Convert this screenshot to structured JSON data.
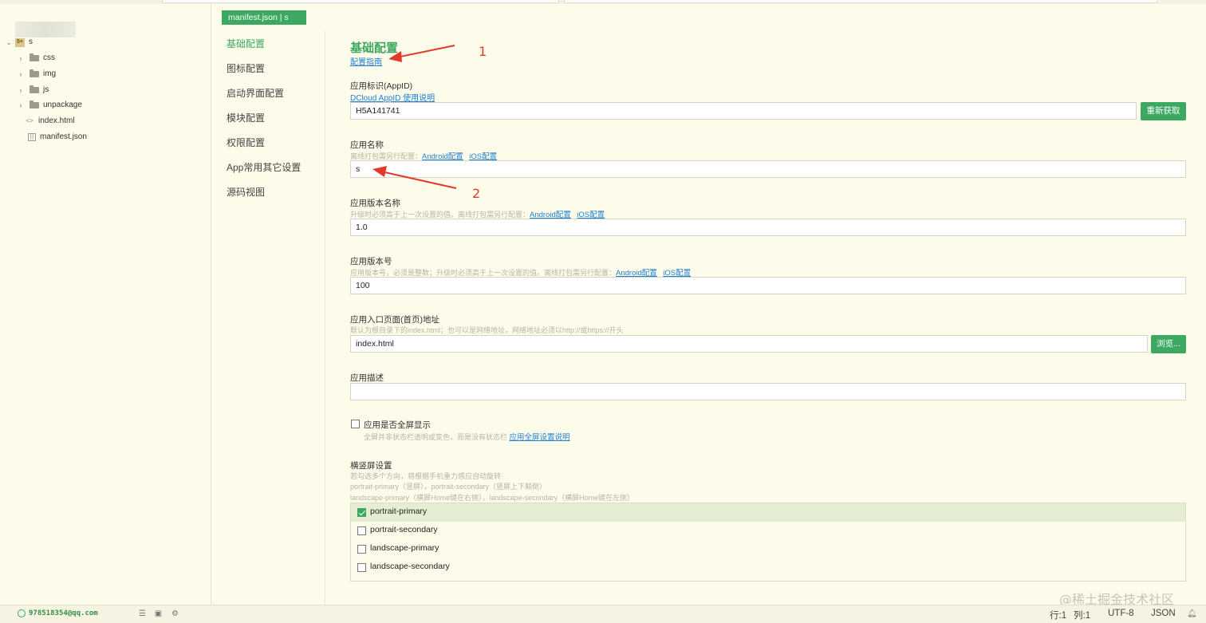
{
  "tree": {
    "project": "s",
    "items": [
      {
        "label": "css",
        "type": "folder"
      },
      {
        "label": "img",
        "type": "folder"
      },
      {
        "label": "js",
        "type": "folder"
      },
      {
        "label": "unpackage",
        "type": "folder"
      },
      {
        "label": "index.html",
        "type": "html"
      },
      {
        "label": "manifest.json",
        "type": "json"
      }
    ]
  },
  "tab": {
    "label": "manifest.json | s"
  },
  "nav": {
    "items": [
      "基础配置",
      "图标配置",
      "启动界面配置",
      "模块配置",
      "权限配置",
      "App常用其它设置",
      "源码视图"
    ],
    "active": "基础配置"
  },
  "main": {
    "title": "基础配置",
    "guide_link": "配置指南",
    "appid": {
      "label": "应用标识(AppID)",
      "help_link": "DCloud AppID 使用说明",
      "value": "H5A141741",
      "button": "重新获取"
    },
    "appname": {
      "label": "应用名称",
      "hint": "离线打包需另行配置：",
      "android_link": "Android配置",
      "ios_link": "iOS配置",
      "value": "s"
    },
    "version_name": {
      "label": "应用版本名称",
      "hint": "升级时必须高于上一次设置的值。离线打包需另行配置：",
      "android_link": "Android配置",
      "ios_link": "iOS配置",
      "value": "1.0"
    },
    "version_code": {
      "label": "应用版本号",
      "hint": "应用版本号，必须是整数；升级时必须高于上一次设置的值。离线打包需另行配置：",
      "android_link": "Android配置",
      "ios_link": "iOS配置",
      "value": "100"
    },
    "entry": {
      "label": "应用入口页面(首页)地址",
      "hint": "默认为根目录下的index.html；也可以是网络地址，网络地址必须以http://或https://开头",
      "value": "index.html",
      "button": "浏览..."
    },
    "description": {
      "label": "应用描述",
      "value": ""
    },
    "fullscreen": {
      "label": "应用是否全屏显示",
      "hint": "全屏并非状态栏透明或变色，而是没有状态栏",
      "link": "应用全屏设置说明",
      "checked": false
    },
    "orientation": {
      "label": "横竖屏设置",
      "hint1": "若勾选多个方向，将根据手机重力感应自动旋转",
      "hint2": "portrait-primary（竖屏），portrait-secondary（竖屏上下颠倒）",
      "hint3": "landscape-primary（横屏Home键在右侧），landscape-secondary（横屏Home键在左侧）",
      "options": [
        {
          "label": "portrait-primary",
          "checked": true
        },
        {
          "label": "portrait-secondary",
          "checked": false
        },
        {
          "label": "landscape-primary",
          "checked": false
        },
        {
          "label": "landscape-secondary",
          "checked": false
        }
      ]
    }
  },
  "annotations": {
    "one": "1",
    "two": "2",
    "color": "#e23a2a"
  },
  "status": {
    "user": "978518354@qq.com",
    "line": "行:1",
    "col": "列:1",
    "encoding": "UTF-8",
    "language": "JSON"
  },
  "watermark": "@稀土掘金技术社区",
  "colors": {
    "accent": "#3ca862",
    "link": "#1f7fd3",
    "background": "#fdfbea"
  }
}
